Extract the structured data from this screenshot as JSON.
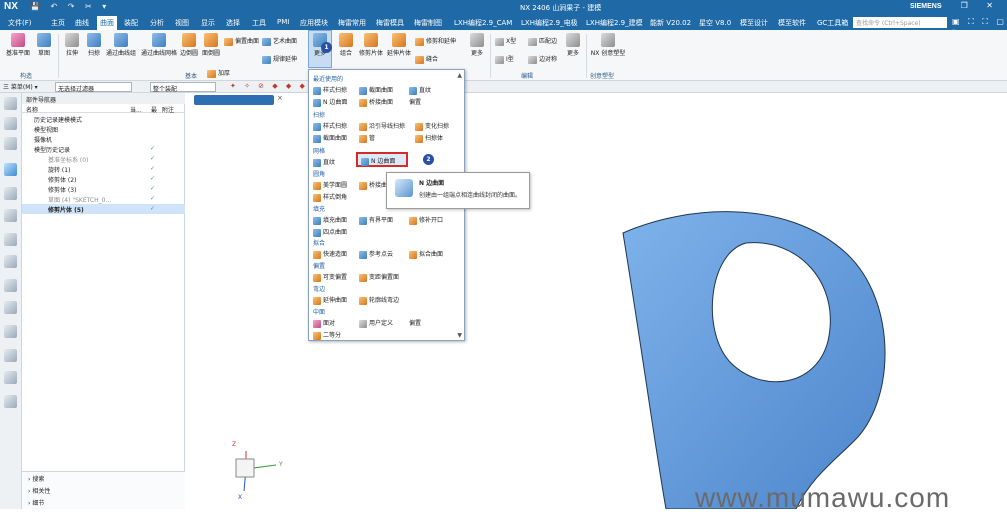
{
  "titlebar": {
    "logo": "NX",
    "quick_access": "💾 ↶ ↷ ✂ ▾",
    "title": "NX 2406 山涧果子 - 建模",
    "brand": "SIEMENS",
    "window_buttons": "– ❐ ✕"
  },
  "menubar": {
    "items": [
      "文件(F)",
      "主页",
      "曲线",
      "曲面",
      "装配",
      "分析",
      "视图",
      "显示",
      "选择",
      "工具",
      "PMI",
      "应用模块",
      "梅雷常用",
      "梅雷模具",
      "梅雷制图",
      "LXH编程2.9_CAM",
      "LXH编程2.9_电极",
      "LXH编程2.9_建模",
      "能新 V20.02",
      "星空 V8.0",
      "模至设计",
      "模至软件",
      "GC工具箱"
    ],
    "search_placeholder": "查找命令 (Ctrl+Space)",
    "right_icons": "▣ ⛶ ⛶ ▢ ▾"
  },
  "ribbon": {
    "buttons": [
      "基准平面",
      "草图",
      "拉伸",
      "扫掠",
      "通过曲线组",
      "通过曲线网格",
      "边倒圆",
      "面倒圆",
      "加厚",
      "偏置曲面",
      "艺术曲面",
      "规律延伸",
      "更多",
      "组合",
      "修剪片体",
      "延伸片体",
      "修剪和延伸",
      "缝合",
      "更多",
      "X型",
      "I型",
      "匹配边",
      "边对称",
      "更多",
      "NX 创意塑型"
    ],
    "small_items": [
      "偏置曲面",
      "艺术曲面",
      "规律延伸"
    ],
    "groups": [
      "构造",
      "基本",
      "编辑",
      "创意塑型"
    ]
  },
  "filterbar": {
    "menu": "三 菜单(M) ▾",
    "filter": "无选择过滤器",
    "assembly": "整个装配"
  },
  "navigator": {
    "title": "部件导航器",
    "columns": [
      "名称",
      "当...",
      "最",
      "附注"
    ],
    "rows": [
      {
        "label": "历史记录建模模式",
        "check": ""
      },
      {
        "label": "模型视图",
        "check": ""
      },
      {
        "label": "摄像机",
        "check": ""
      },
      {
        "label": "模型历史记录",
        "check": "✓"
      },
      {
        "label": "基准坐标系 (0)",
        "check": "✓"
      },
      {
        "label": "旋转 (1)",
        "check": "✓"
      },
      {
        "label": "修剪体 (2)",
        "check": "✓"
      },
      {
        "label": "修剪体 (3)",
        "check": "✓"
      },
      {
        "label": "草图 (4) \"SKETCH_0...",
        "check": "✓"
      },
      {
        "label": "修剪片体 (5)",
        "check": "✓"
      }
    ],
    "bottom": [
      "搜索",
      "相关性",
      "细节"
    ]
  },
  "dropdown": {
    "sections": [
      {
        "title": "最近使用的",
        "items": [
          "样式扫掠",
          "截面曲面",
          "直纹",
          "N 边曲面",
          "桥接曲面",
          "偏置"
        ]
      },
      {
        "title": "扫掠",
        "items": [
          "样式扫掠",
          "沿引导线扫掠",
          "变化扫掠",
          "截面曲面",
          "管",
          "扫掠体"
        ]
      },
      {
        "title": "网格",
        "items": [
          "直纹",
          "N 边曲面"
        ]
      },
      {
        "title": "圆角",
        "items": [
          "美学面圆",
          "桥接曲面",
          "样式倒角"
        ]
      },
      {
        "title": "填充",
        "items": [
          "填充曲面",
          "有界平面",
          "修补开口",
          "四点曲面"
        ]
      },
      {
        "title": "拟合",
        "items": [
          "快速造面",
          "参考点云",
          "拟合曲面"
        ]
      },
      {
        "title": "偏置",
        "items": [
          "可变偏置",
          "变距偏置面"
        ]
      },
      {
        "title": "弯边",
        "items": [
          "延伸曲面",
          "轮廓线弯边"
        ]
      },
      {
        "title": "中面",
        "items": [
          "面对",
          "用户定义",
          "偏置",
          "二等分"
        ]
      }
    ]
  },
  "tooltip": {
    "title": "N 边曲面",
    "description": "创建由一组端点相连曲线封闭的曲面。"
  },
  "badges": [
    "1",
    "2"
  ],
  "axes": {
    "x": "X",
    "y": "Y",
    "z": "Z"
  },
  "watermark": "www.mumawu.com",
  "colors": {
    "brand": "#1f6aa6",
    "surface": "#5b93d6",
    "highlight": "#d42a2a"
  }
}
